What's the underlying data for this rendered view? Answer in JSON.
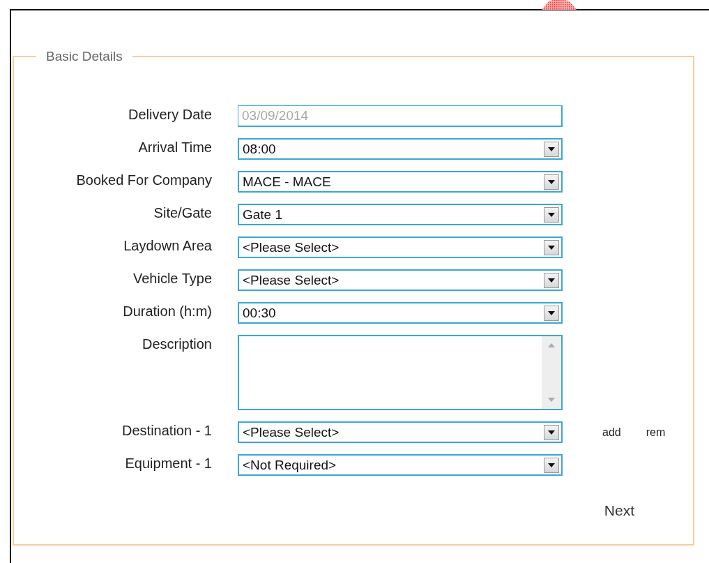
{
  "section": {
    "legend": "Basic Details"
  },
  "fields": [
    {
      "label": "Delivery Date",
      "kind": "text",
      "value": "03/09/2014",
      "disabled": true
    },
    {
      "label": "Arrival Time",
      "kind": "select",
      "value": "08:00",
      "disabled": false
    },
    {
      "label": "Booked For Company",
      "kind": "select",
      "value": "MACE - MACE",
      "disabled": false
    },
    {
      "label": "Site/Gate",
      "kind": "select",
      "value": "Gate 1",
      "disabled": false
    },
    {
      "label": "Laydown Area",
      "kind": "select",
      "value": "<Please Select>",
      "disabled": false
    },
    {
      "label": "Vehicle Type",
      "kind": "select",
      "value": "<Please Select>",
      "disabled": false
    },
    {
      "label": "Duration (h:m)",
      "kind": "select",
      "value": "00:30",
      "disabled": false
    },
    {
      "label": "Description",
      "kind": "textarea",
      "disabled": false
    },
    {
      "label": "Destination - 1",
      "kind": "select",
      "value": "<Please Select>",
      "disabled": false,
      "actions": [
        "add",
        "rem"
      ]
    },
    {
      "label": "Equipment - 1",
      "kind": "select",
      "value": "<Not Required>",
      "disabled": false
    }
  ],
  "buttons": [
    "Next"
  ]
}
